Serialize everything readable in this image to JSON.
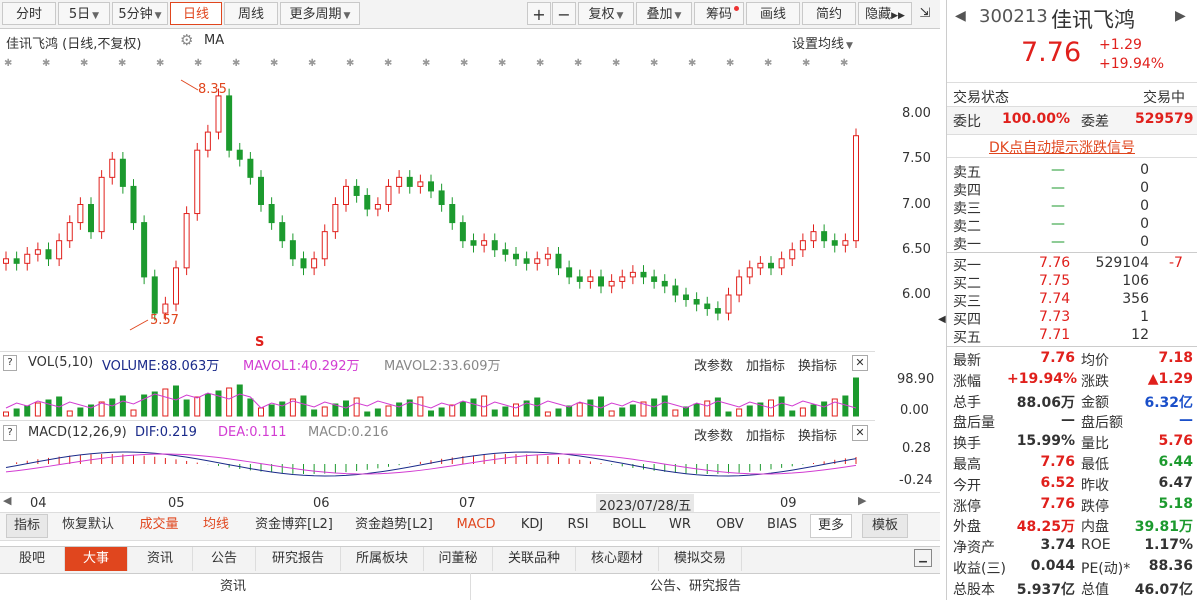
{
  "toolbar": {
    "items": [
      {
        "label": "分时"
      },
      {
        "label": "5日",
        "caret": true
      },
      {
        "label": "5分钟",
        "caret": true
      },
      {
        "label": "日线",
        "active": true
      },
      {
        "label": "周线"
      },
      {
        "label": "更多周期",
        "caret": true
      }
    ],
    "right_items": [
      {
        "label": "+"
      },
      {
        "label": "−"
      },
      {
        "label": "复权",
        "caret": true
      },
      {
        "label": "叠加",
        "caret": true
      },
      {
        "label": "筹码",
        "dot": true
      },
      {
        "label": "画线"
      },
      {
        "label": "简约"
      },
      {
        "label": "隐藏"
      }
    ]
  },
  "kline": {
    "title": "佳讯飞鸿 (日线,不复权)",
    "ma_label": "MA",
    "settings_label": "设置均线",
    "high_label": "8.35",
    "low_label": "5.57",
    "y_ticks": [
      "8.00",
      "7.50",
      "7.00",
      "6.50",
      "6.00"
    ]
  },
  "vol": {
    "name": "VOL(5,10)",
    "volume": "VOLUME:88.063万",
    "mavol1": "MAVOL1:40.292万",
    "mavol2": "MAVOL2:33.609万",
    "y_ticks": [
      "98.90",
      "0.00"
    ],
    "buttons": [
      "改参数",
      "加指标",
      "换指标"
    ]
  },
  "macd": {
    "name": "MACD(12,26,9)",
    "dif": "DIF:0.219",
    "dea": "DEA:0.111",
    "macd": "MACD:0.216",
    "y_ticks": [
      "0.28",
      "-0.24"
    ],
    "buttons": [
      "改参数",
      "加指标",
      "换指标"
    ]
  },
  "xaxis": {
    "months": [
      "04",
      "05",
      "06",
      "07",
      "09"
    ],
    "cursor_date": "2023/07/28/五"
  },
  "indicator_tabs": [
    "指标",
    "恢复默认",
    "成交量",
    "均线",
    "资金博弈[L2]",
    "资金趋势[L2]",
    "MACD",
    "KDJ",
    "RSI",
    "BOLL",
    "WR",
    "OBV",
    "BIAS",
    "更多",
    "模板"
  ],
  "bottom_tabs": [
    "股吧",
    "大事",
    "资讯",
    "公告",
    "研究报告",
    "所属板块",
    "问董秘",
    "关联品种",
    "核心题材",
    "模拟交易"
  ],
  "bottom_headers": [
    "资讯",
    "公告、研究报告"
  ],
  "quote": {
    "code": "300213",
    "name": "佳讯飞鸿",
    "price": "7.76",
    "change": "+1.29",
    "change_pct": "+19.94%",
    "status_label": "交易状态",
    "status_value": "交易中",
    "weibi_label": "委比",
    "weibi_value": "100.00%",
    "weicha_label": "委差",
    "weicha_value": "529579",
    "dk_link": "DK点自动提示涨跌信号",
    "sell": [
      {
        "label": "卖五",
        "price": "—",
        "vol": "0"
      },
      {
        "label": "卖四",
        "price": "—",
        "vol": "0"
      },
      {
        "label": "卖三",
        "price": "—",
        "vol": "0"
      },
      {
        "label": "卖二",
        "price": "—",
        "vol": "0"
      },
      {
        "label": "卖一",
        "price": "—",
        "vol": "0"
      }
    ],
    "buy": [
      {
        "label": "买一",
        "price": "7.76",
        "vol": "529104",
        "delta": "-7"
      },
      {
        "label": "买二",
        "price": "7.75",
        "vol": "106",
        "delta": ""
      },
      {
        "label": "买三",
        "price": "7.74",
        "vol": "356",
        "delta": ""
      },
      {
        "label": "买四",
        "price": "7.73",
        "vol": "1",
        "delta": ""
      },
      {
        "label": "买五",
        "price": "7.71",
        "vol": "12",
        "delta": ""
      }
    ],
    "stats": [
      {
        "l1": "最新",
        "v1": "7.76",
        "c1": "red",
        "l2": "均价",
        "v2": "7.18",
        "c2": "red"
      },
      {
        "l1": "涨幅",
        "v1": "+19.94%",
        "c1": "red",
        "l2": "涨跌",
        "v2": "▲1.29",
        "c2": "red"
      },
      {
        "l1": "总手",
        "v1": "88.06万",
        "c1": "",
        "l2": "金额",
        "v2": "6.32亿",
        "c2": "blue"
      },
      {
        "l1": "盘后量",
        "v1": "—",
        "c1": "",
        "l2": "盘后额",
        "v2": "—",
        "c2": "blue"
      },
      {
        "l1": "换手",
        "v1": "15.99%",
        "c1": "",
        "l2": "量比",
        "v2": "5.76",
        "c2": "red"
      },
      {
        "l1": "最高",
        "v1": "7.76",
        "c1": "red",
        "l2": "最低",
        "v2": "6.44",
        "c2": "green"
      },
      {
        "l1": "今开",
        "v1": "6.52",
        "c1": "red",
        "l2": "昨收",
        "v2": "6.47",
        "c2": ""
      },
      {
        "l1": "涨停",
        "v1": "7.76",
        "c1": "red",
        "l2": "跌停",
        "v2": "5.18",
        "c2": "green"
      },
      {
        "l1": "外盘",
        "v1": "48.25万",
        "c1": "red",
        "l2": "内盘",
        "v2": "39.81万",
        "c2": "green"
      },
      {
        "l1": "净资产",
        "v1": "3.74",
        "c1": "",
        "l2": "ROE",
        "v2": "1.17%",
        "c2": ""
      },
      {
        "l1": "收益(三)",
        "v1": "0.044",
        "c1": "",
        "l2": "PE(动)*",
        "v2": "88.36",
        "c2": ""
      },
      {
        "l1": "总股本",
        "v1": "5.937亿",
        "c1": "",
        "l2": "总值",
        "v2": "46.07亿",
        "c2": ""
      }
    ]
  },
  "colors": {
    "up": "#e0201c",
    "down": "#1c9a2e",
    "accent": "#e0461e",
    "mavol1": "#d23cd2",
    "dif": "#1a2a8a",
    "dea": "#d23cd2"
  }
}
